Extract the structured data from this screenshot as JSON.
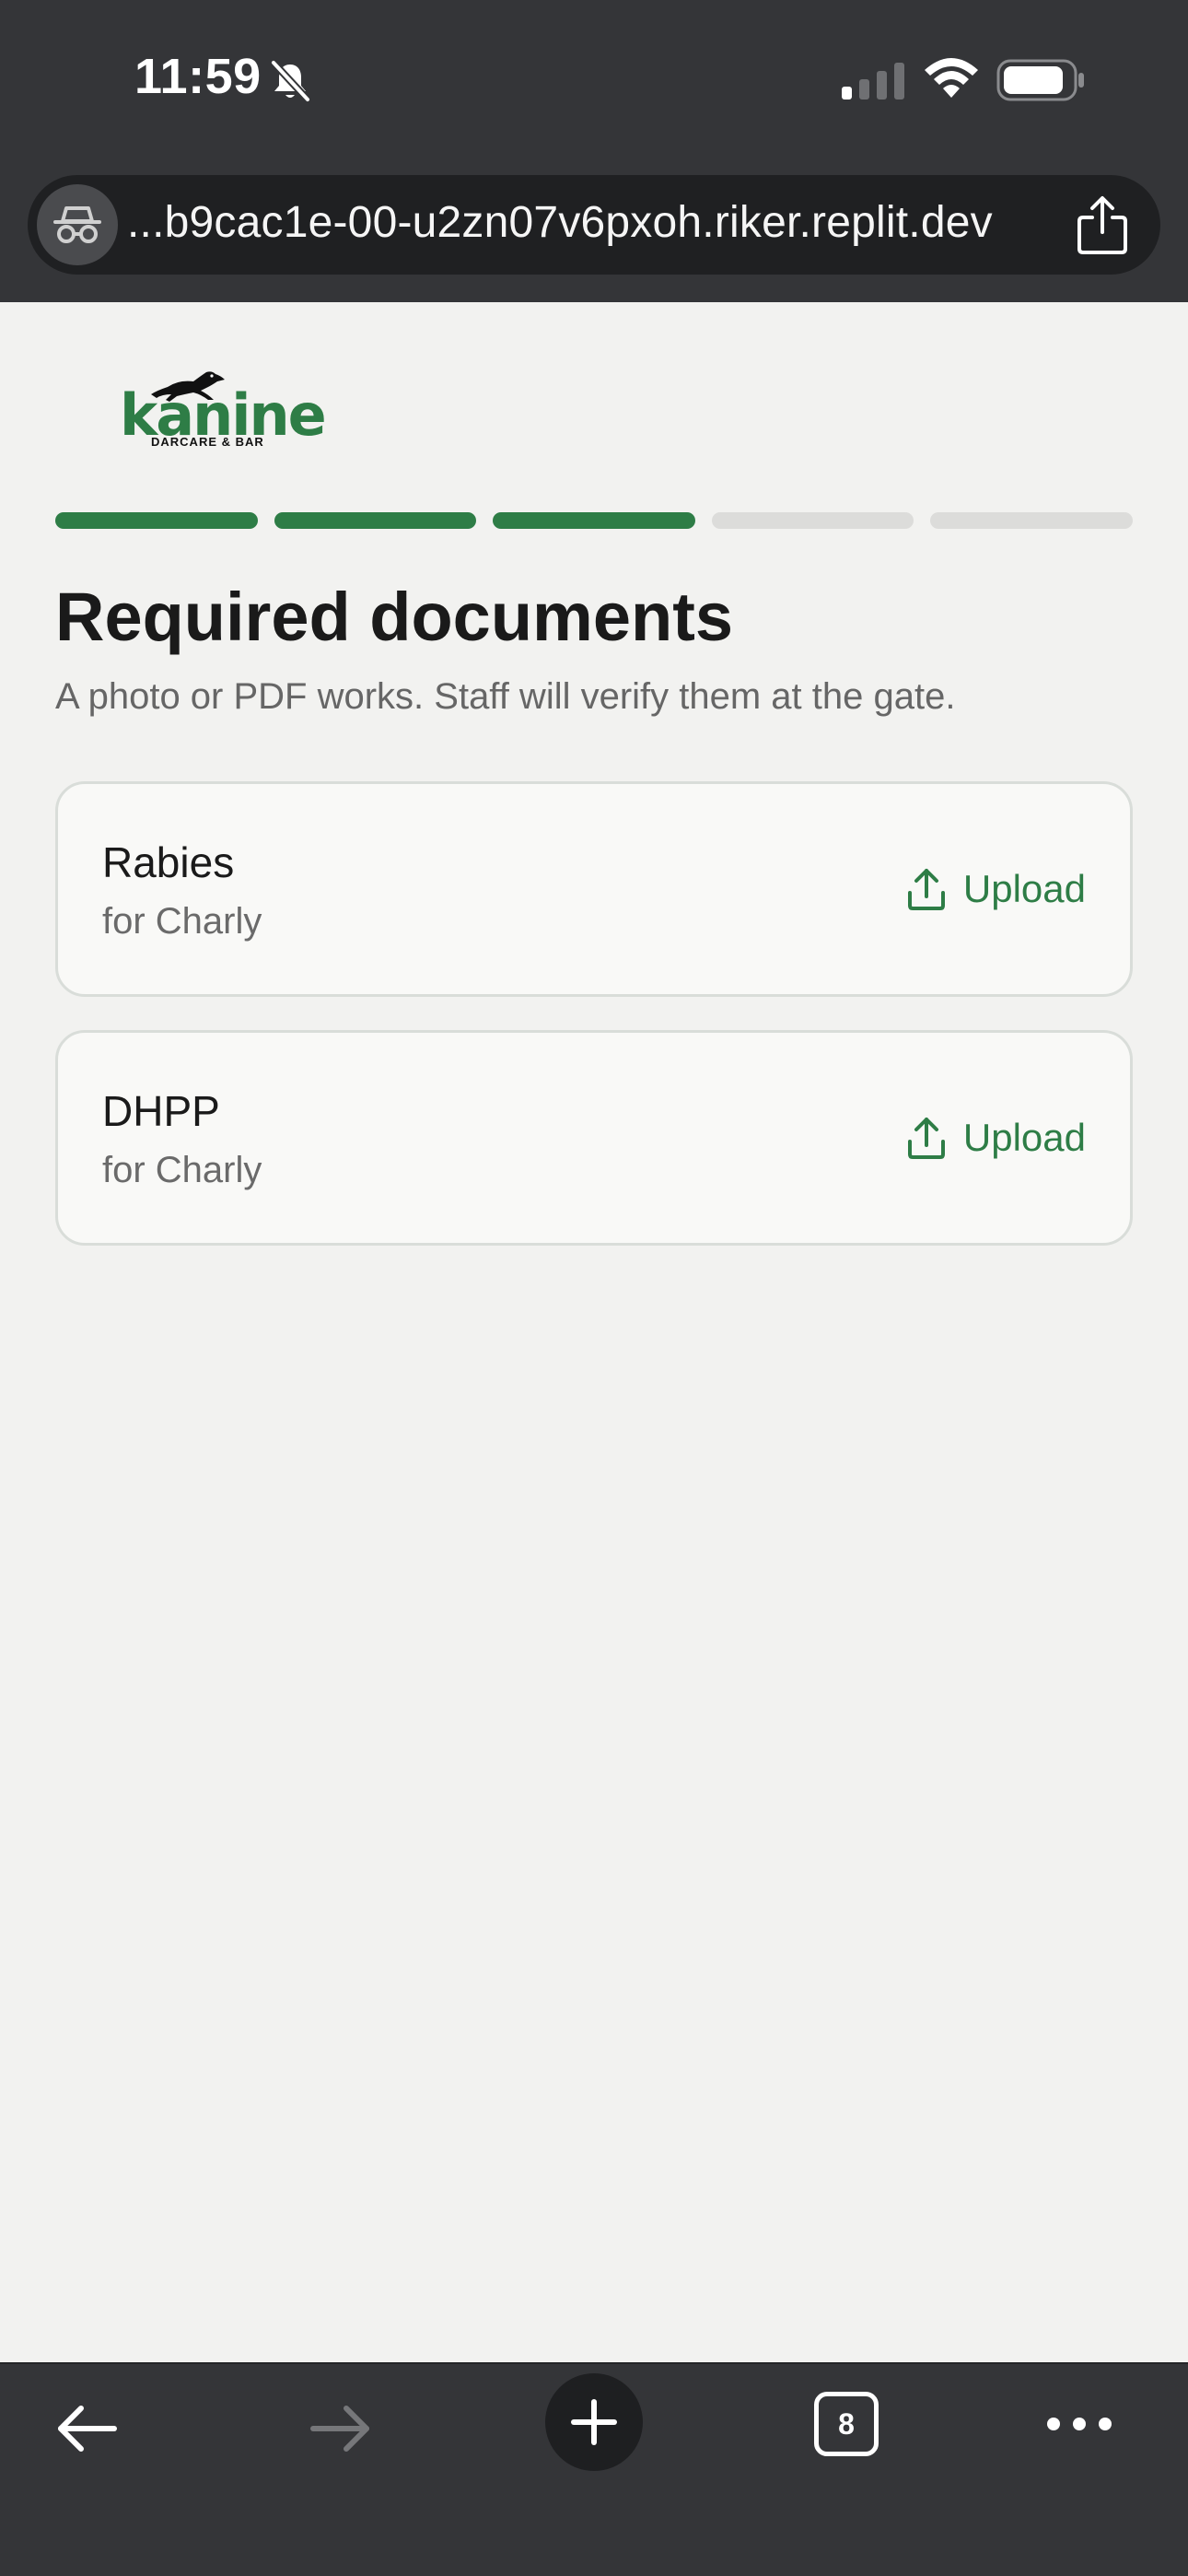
{
  "status_bar": {
    "time": "11:59"
  },
  "browser": {
    "url": "...b9cac1e-00-u2zn07v6pxoh.riker.replit.dev",
    "open_tabs_count": "8"
  },
  "brand": {
    "name": "kanine",
    "tagline": "DARCARE & BAR",
    "color": "#2e7d46"
  },
  "progress": {
    "total_steps": 5,
    "completed_steps": 3
  },
  "page": {
    "title": "Required documents",
    "subtitle": "A photo or PDF works. Staff will verify them at the gate."
  },
  "documents": [
    {
      "name": "Rabies",
      "owner": "for Charly",
      "action_label": "Upload"
    },
    {
      "name": "DHPP",
      "owner": "for Charly",
      "action_label": "Upload"
    }
  ],
  "icons": {
    "status": [
      "bell-slash-icon",
      "cellular-signal-icon",
      "wifi-icon",
      "battery-icon"
    ],
    "url_bar": [
      "incognito-icon",
      "share-icon"
    ],
    "document_action": "upload-icon",
    "toolbar": [
      "back-arrow-icon",
      "forward-arrow-icon",
      "plus-icon",
      "tabs-icon",
      "more-icon"
    ]
  }
}
